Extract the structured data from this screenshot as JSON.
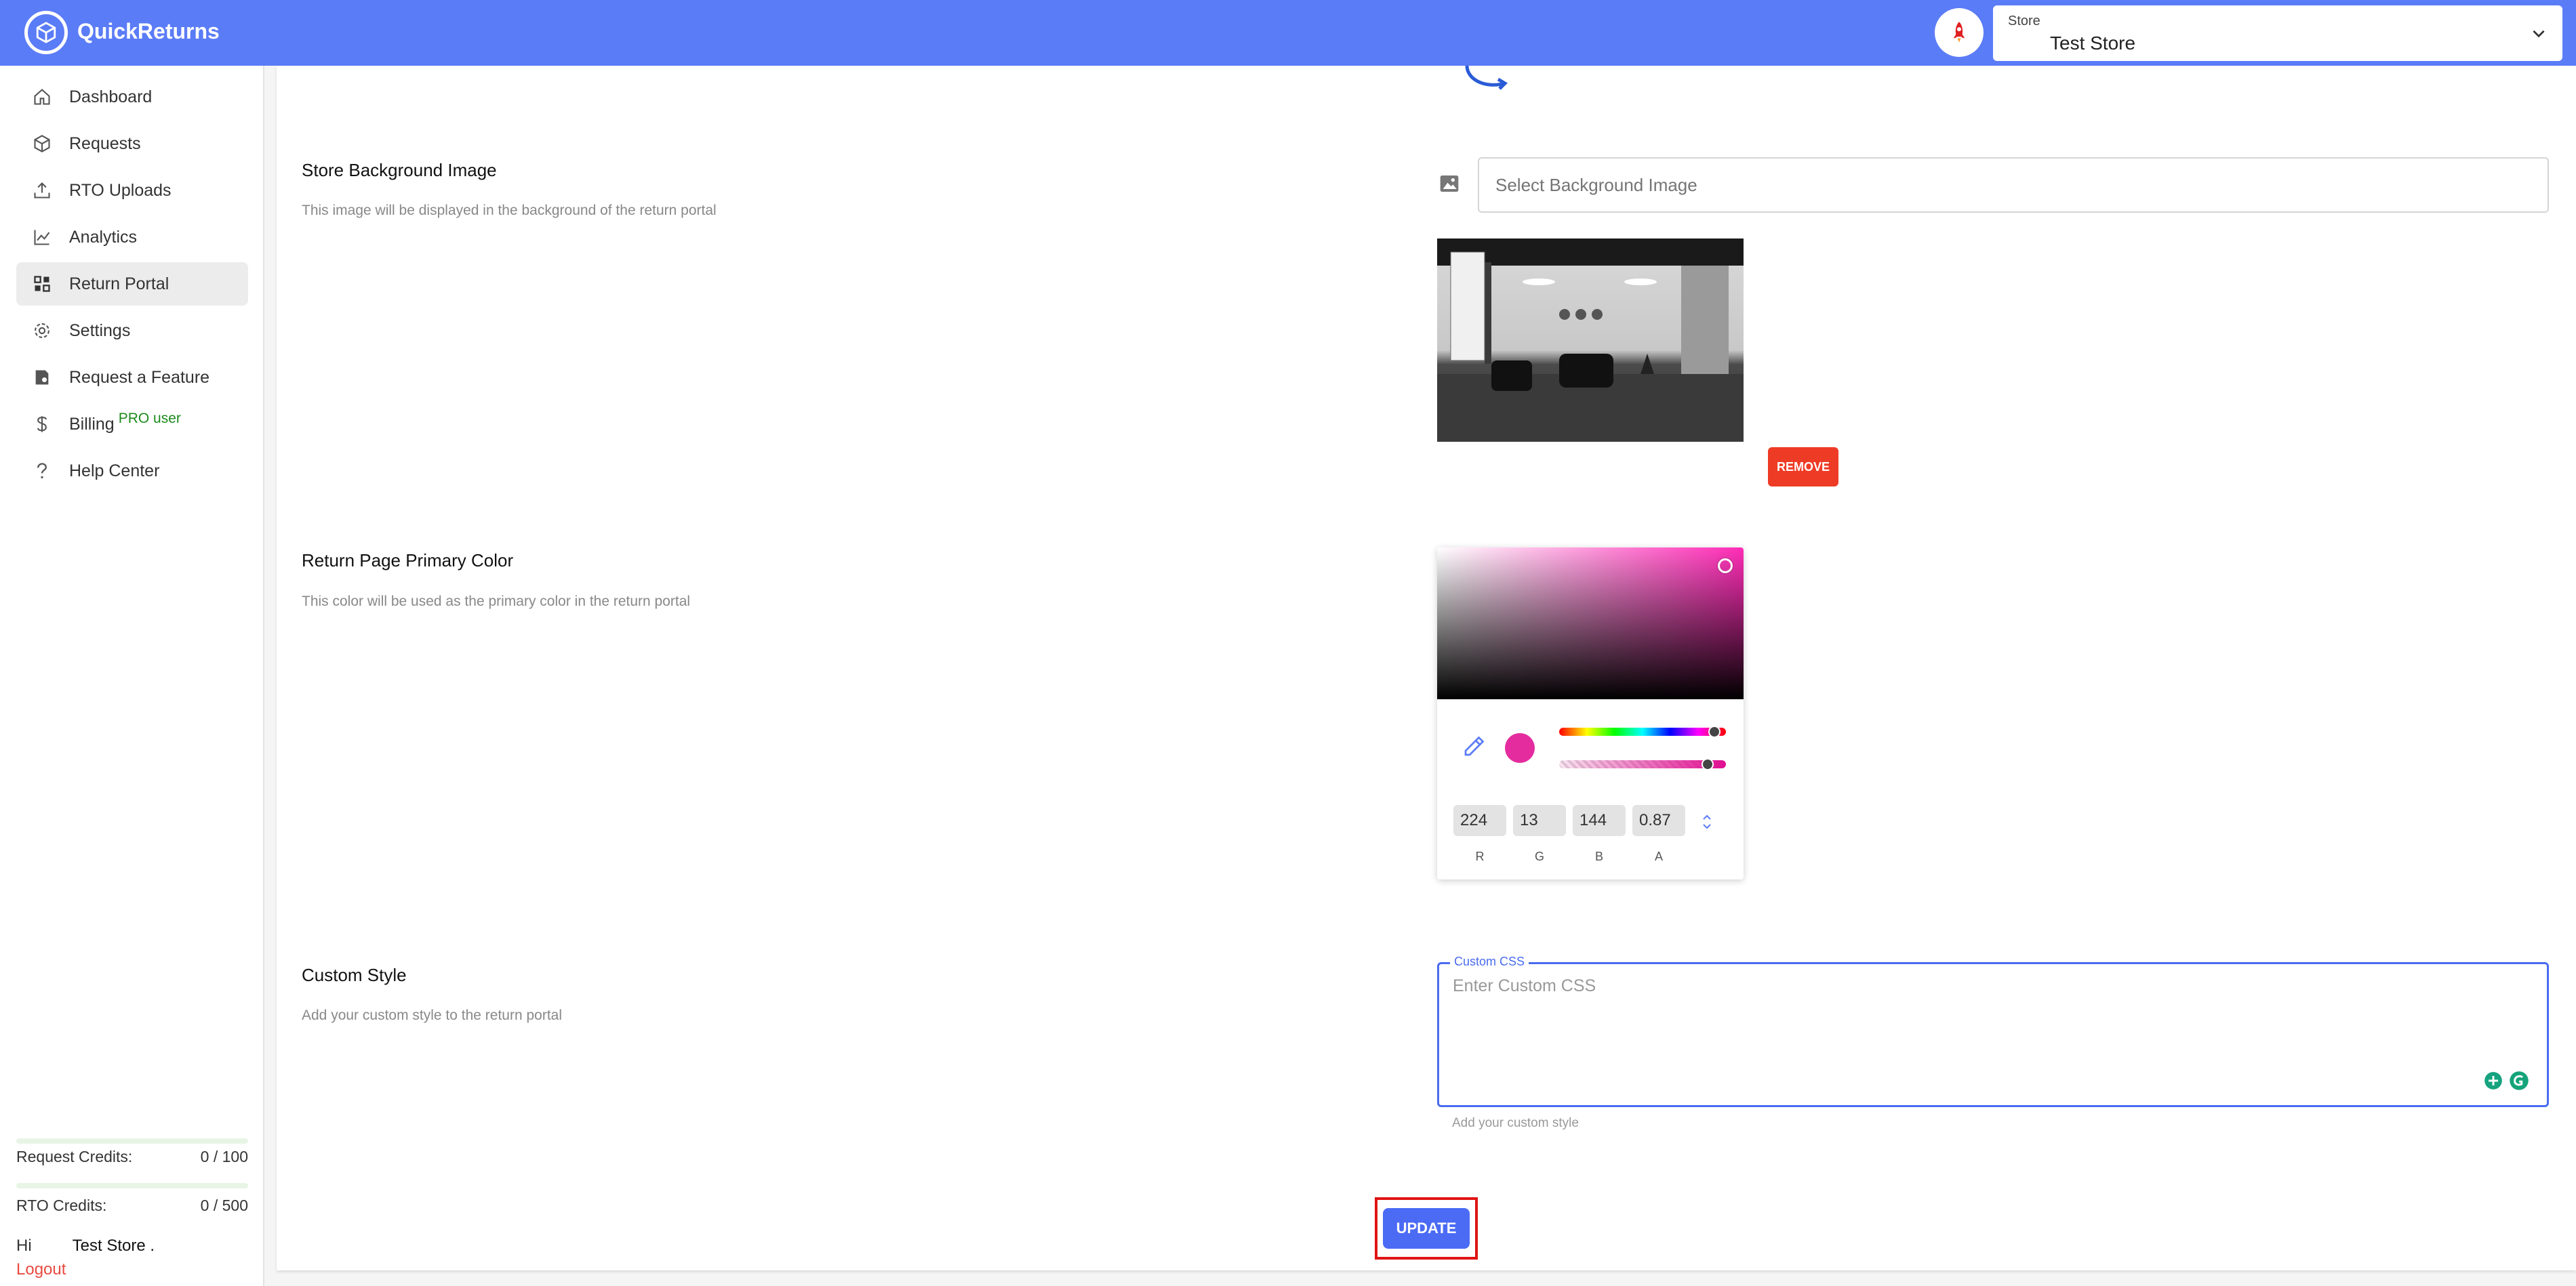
{
  "app": {
    "title": "QuickReturns"
  },
  "store_select": {
    "label": "Store",
    "value": "Test Store"
  },
  "sidebar": {
    "items": [
      {
        "label": "Dashboard",
        "icon": "home-icon"
      },
      {
        "label": "Requests",
        "icon": "box-icon"
      },
      {
        "label": "RTO Uploads",
        "icon": "upload-icon"
      },
      {
        "label": "Analytics",
        "icon": "chart-icon"
      },
      {
        "label": "Return Portal",
        "icon": "grid-icon",
        "active": true
      },
      {
        "label": "Settings",
        "icon": "gear-icon"
      },
      {
        "label": "Request a Feature",
        "icon": "feature-icon"
      },
      {
        "label": "Billing",
        "icon": "dollar-icon",
        "badge": "PRO user"
      },
      {
        "label": "Help Center",
        "icon": "question-icon"
      }
    ],
    "credits": [
      {
        "label": "Request Credits:",
        "value": "0 / 100"
      },
      {
        "label": "RTO Credits:",
        "value": "0 / 500"
      }
    ],
    "greeting": "Hi",
    "user_name": "Test Store .",
    "logout": "Logout"
  },
  "background_section": {
    "title": "Store Background Image",
    "description": "This image will be displayed in the background of the return portal",
    "input_placeholder": "Select Background Image",
    "remove_label": "REMOVE"
  },
  "color_section": {
    "title": "Return Page Primary Color",
    "description": "This color will be used as the primary color in the return portal",
    "rgba": {
      "r": "224",
      "g": "13",
      "b": "144",
      "a": "0.87"
    },
    "labels": {
      "r": "R",
      "g": "G",
      "b": "B",
      "a": "A"
    },
    "color_hex": "#e00d90"
  },
  "style_section": {
    "title": "Custom Style",
    "description": "Add your custom style to the return portal",
    "field_label": "Custom CSS",
    "placeholder": "Enter Custom CSS",
    "helper": "Add your custom style"
  },
  "update_label": "UPDATE",
  "colors": {
    "header": "#5b7cf7",
    "accent": "#4b6bf5",
    "danger": "#ee3b25"
  }
}
